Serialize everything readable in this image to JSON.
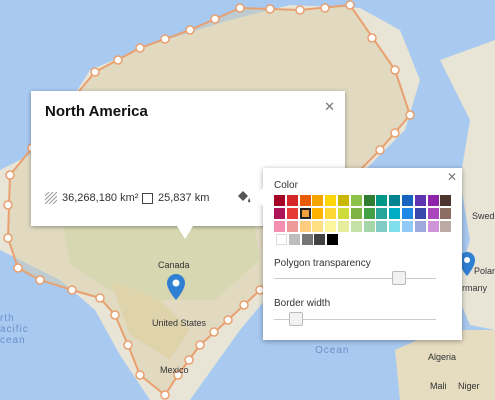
{
  "map": {
    "labels": {
      "canada": "Canada",
      "united_states": "United States",
      "mexico": "Mexico",
      "algeria": "Algeria",
      "mali": "Mali",
      "niger": "Niger",
      "sweden": "Swede",
      "poland": "Polan",
      "germany": "rmany",
      "north_pacific_ocean": "rth\nacific\ncean",
      "atlantic_ocean": "Ocean"
    },
    "colors": {
      "water": "#a8c9f0",
      "land": "#e8e4d6",
      "polygon_fill": "#d9cfa8",
      "polygon_border": "#e9a070",
      "pin": "#2f7fd3"
    }
  },
  "info_window": {
    "title": "North America",
    "area": "36,268,180 km²",
    "perimeter": "25,837 km",
    "icons": {
      "close": "close-icon",
      "area": "area-hatch-icon",
      "perimeter": "square-outline-icon",
      "style": "paint-bucket-icon"
    }
  },
  "style_panel": {
    "color_label": "Color",
    "transparency_label": "Polygon transparency",
    "border_label": "Border width",
    "transparency_value": 0.8,
    "border_width_value": 0.1,
    "selected_color": "#f0a040",
    "palette": [
      [
        "#a50026",
        "#d62728",
        "#e85d04",
        "#f7a400",
        "#ffd60a",
        "#c8b900",
        "#8bc34a",
        "#2e7d32",
        "#009688",
        "#00838f",
        "#1565c0",
        "#5e35b1",
        "#8e24aa",
        "#4e342e"
      ],
      [
        "#ad1457",
        "#e53935",
        "#f0a040",
        "#ffb300",
        "#fdd835",
        "#cddc39",
        "#7cb342",
        "#43a047",
        "#26a69a",
        "#00acc1",
        "#1e88e5",
        "#3949ab",
        "#ab47bc",
        "#8d6e63"
      ],
      [
        "#f48fb1",
        "#ef9a9a",
        "#ffcc80",
        "#ffe082",
        "#fff59d",
        "#e6ee9c",
        "#c5e1a5",
        "#a5d6a7",
        "#80cbc4",
        "#80deea",
        "#90caf9",
        "#9fa8da",
        "#ce93d8",
        "#bcaaa4"
      ],
      [
        "#ffffff",
        "#bdbdbd",
        "#757575",
        "#424242",
        "#000000"
      ]
    ]
  }
}
